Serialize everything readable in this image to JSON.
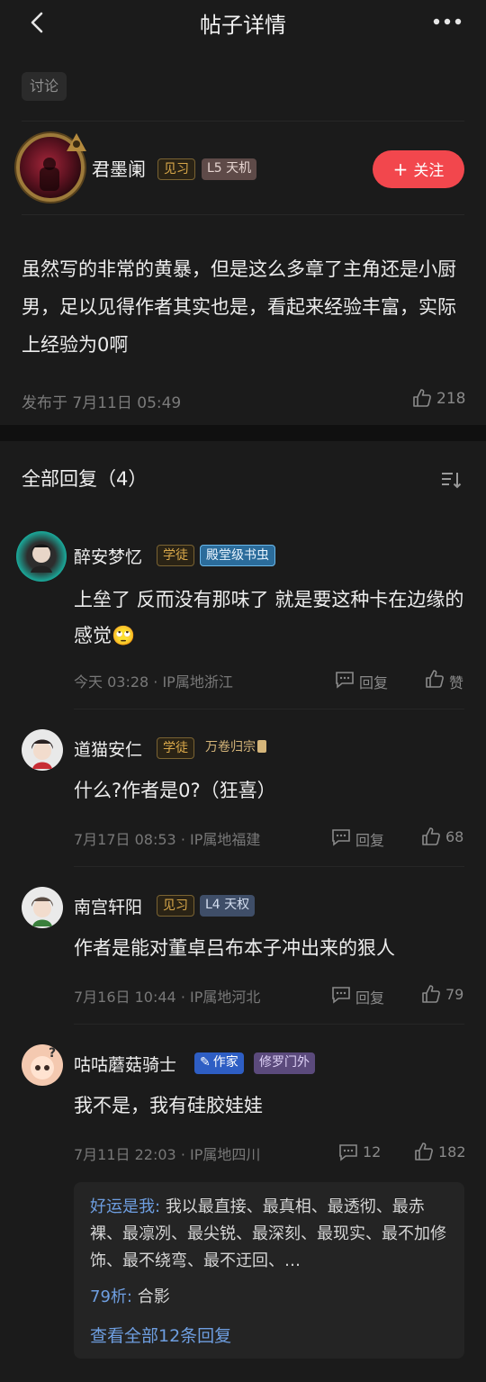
{
  "header": {
    "title": "帖子详情"
  },
  "post": {
    "tag": "讨论",
    "author": {
      "name": "君墨阑",
      "badge1": "见习",
      "badge2": "L5 天机"
    },
    "follow_label": "关注",
    "body": "虽然写的非常的黄暴，但是这么多章了主角还是小厨男，足以见得作者其实也是，看起来经验丰富，实际上经验为0啊",
    "date": "发布于 7月11日 05:49",
    "likes": "218"
  },
  "replies": {
    "title": "全部回复（4）",
    "items": [
      {
        "name": "醉安梦忆",
        "badge1": "学徒",
        "badge2": "殿堂级书虫",
        "text": "上垒了 反而没有那味了 就是要这种卡在边缘的感觉",
        "emoji": "🙄",
        "meta": "今天 03:28 · IP属地浙江",
        "reply_label": "回复",
        "like_label": "赞"
      },
      {
        "name": "道猫安仁",
        "badge1": "学徒",
        "badge2": "万卷归宗",
        "text": "什么?作者是0?（狂喜）",
        "meta": "7月17日 08:53 · IP属地福建",
        "reply_label": "回复",
        "likes": "68"
      },
      {
        "name": "南宫轩阳",
        "badge1": "见习",
        "badge2": "L4 天权",
        "text": "作者是能对董卓吕布本子冲出来的狠人",
        "meta": "7月16日 10:44 · IP属地河北",
        "reply_label": "回复",
        "likes": "79"
      },
      {
        "name": "咕咕蘑菇骑士",
        "badge1": "作家",
        "badge2": "修罗门外",
        "text": "我不是，我有硅胶娃娃",
        "meta": "7月11日 22:03 · IP属地四川",
        "comments": "12",
        "likes": "182",
        "subreplies": [
          {
            "name": "好运是我:",
            "text": "我以最直接、最真相、最透彻、最赤裸、最凛冽、最尖锐、最深刻、最现实、最不加修饰、最不绕弯、最不迂回、…"
          },
          {
            "name": "79析:",
            "text": "合影"
          }
        ],
        "view_all": "查看全部12条回复"
      }
    ]
  }
}
